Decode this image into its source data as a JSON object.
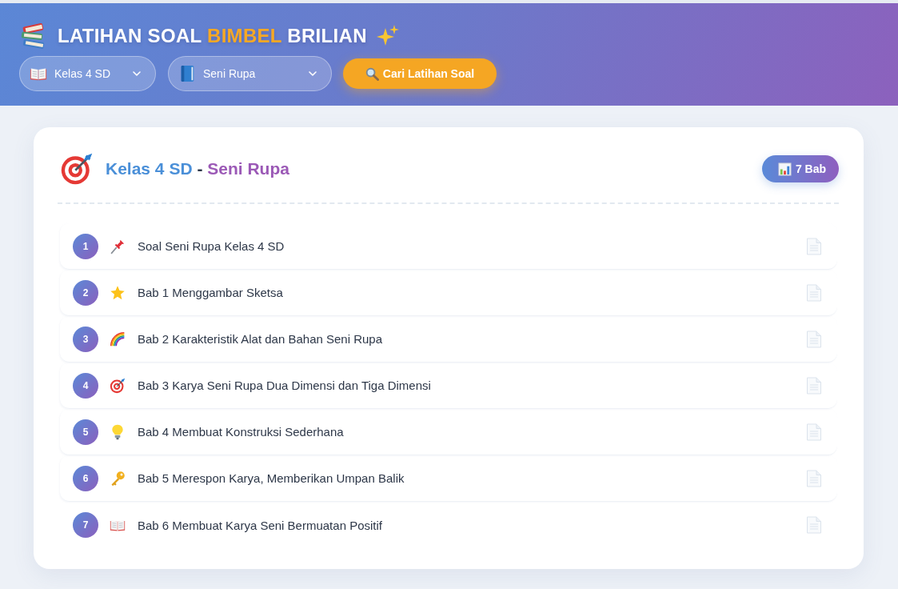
{
  "header": {
    "title": {
      "prefix": "LATIHAN SOAL",
      "highlight": "BIMBEL",
      "suffix": "BRILIAN"
    },
    "filters": [
      {
        "kind": "grade",
        "value": "Kelas 4 SD"
      },
      {
        "kind": "subject",
        "value": "Seni Rupa"
      }
    ],
    "search_button": {
      "label": "Cari Latihan Soal"
    }
  },
  "card": {
    "title": {
      "grade": "Kelas 4 SD",
      "separator": "-",
      "subject": "Seni Rupa"
    },
    "count_badge": "7 Bab",
    "chapters": [
      {
        "number": "1",
        "kind": "pin",
        "title": "Soal Seni Rupa Kelas 4 SD"
      },
      {
        "number": "2",
        "kind": "star",
        "title": "Bab 1 Menggambar Sketsa"
      },
      {
        "number": "3",
        "kind": "rainbow",
        "title": "Bab 2 Karakteristik Alat dan Bahan Seni Rupa"
      },
      {
        "number": "4",
        "kind": "target",
        "title": "Bab 3 Karya Seni Rupa Dua Dimensi dan Tiga Dimensi"
      },
      {
        "number": "5",
        "kind": "bulb",
        "title": "Bab 4 Membuat Konstruksi Sederhana"
      },
      {
        "number": "6",
        "kind": "key",
        "title": "Bab 5 Merespon Karya, Memberikan Umpan Balik"
      },
      {
        "number": "7",
        "kind": "book",
        "title": "Bab 6 Membuat Karya Seni Bermuatan Positif"
      }
    ]
  }
}
